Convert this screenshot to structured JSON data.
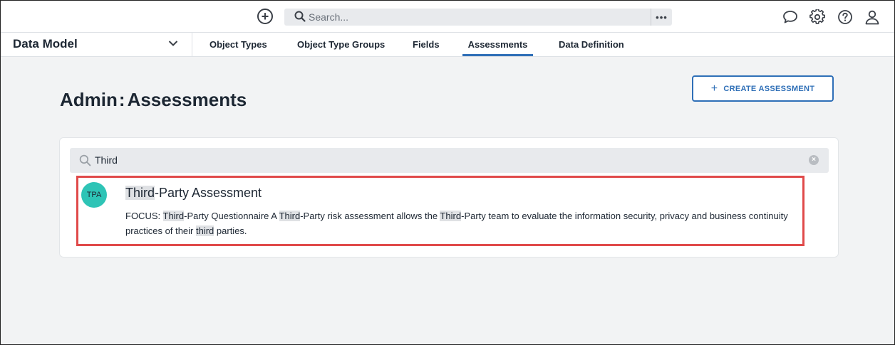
{
  "topbar": {
    "search_placeholder": "Search...",
    "more_label": "•••",
    "icons": [
      "add-icon",
      "search-icon",
      "chat-icon",
      "gear-icon",
      "help-icon",
      "user-icon"
    ]
  },
  "navbar": {
    "module": "Data Model",
    "tabs": [
      {
        "label": "Object Types"
      },
      {
        "label": "Object Type Groups"
      },
      {
        "label": "Fields"
      },
      {
        "label": "Assessments",
        "active": true
      },
      {
        "label": "Data Definition"
      }
    ]
  },
  "page": {
    "title_prefix": "Admin",
    "title_sep": ":",
    "title_main": "Assessments",
    "create_button": "CREATE ASSESSMENT"
  },
  "card": {
    "search_value": "Third",
    "result": {
      "avatar": "TPA",
      "title_hl": "Third",
      "title_rest": "-Party Assessment",
      "desc_parts": [
        {
          "text": "FOCUS: "
        },
        {
          "text": "Third",
          "hl": true
        },
        {
          "text": "-Party Questionnaire A "
        },
        {
          "text": "Third",
          "hl": true
        },
        {
          "text": "-Party risk assessment allows the "
        },
        {
          "text": "Third",
          "hl": true
        },
        {
          "text": "-Party team to evaluate the information security, privacy and business continuity practices of their "
        },
        {
          "text": "third",
          "hl": true
        },
        {
          "text": " parties."
        }
      ]
    }
  },
  "colors": {
    "accent": "#2f6fb7",
    "avatar": "#2ec4b6",
    "highlight_border": "#e04a4a"
  }
}
